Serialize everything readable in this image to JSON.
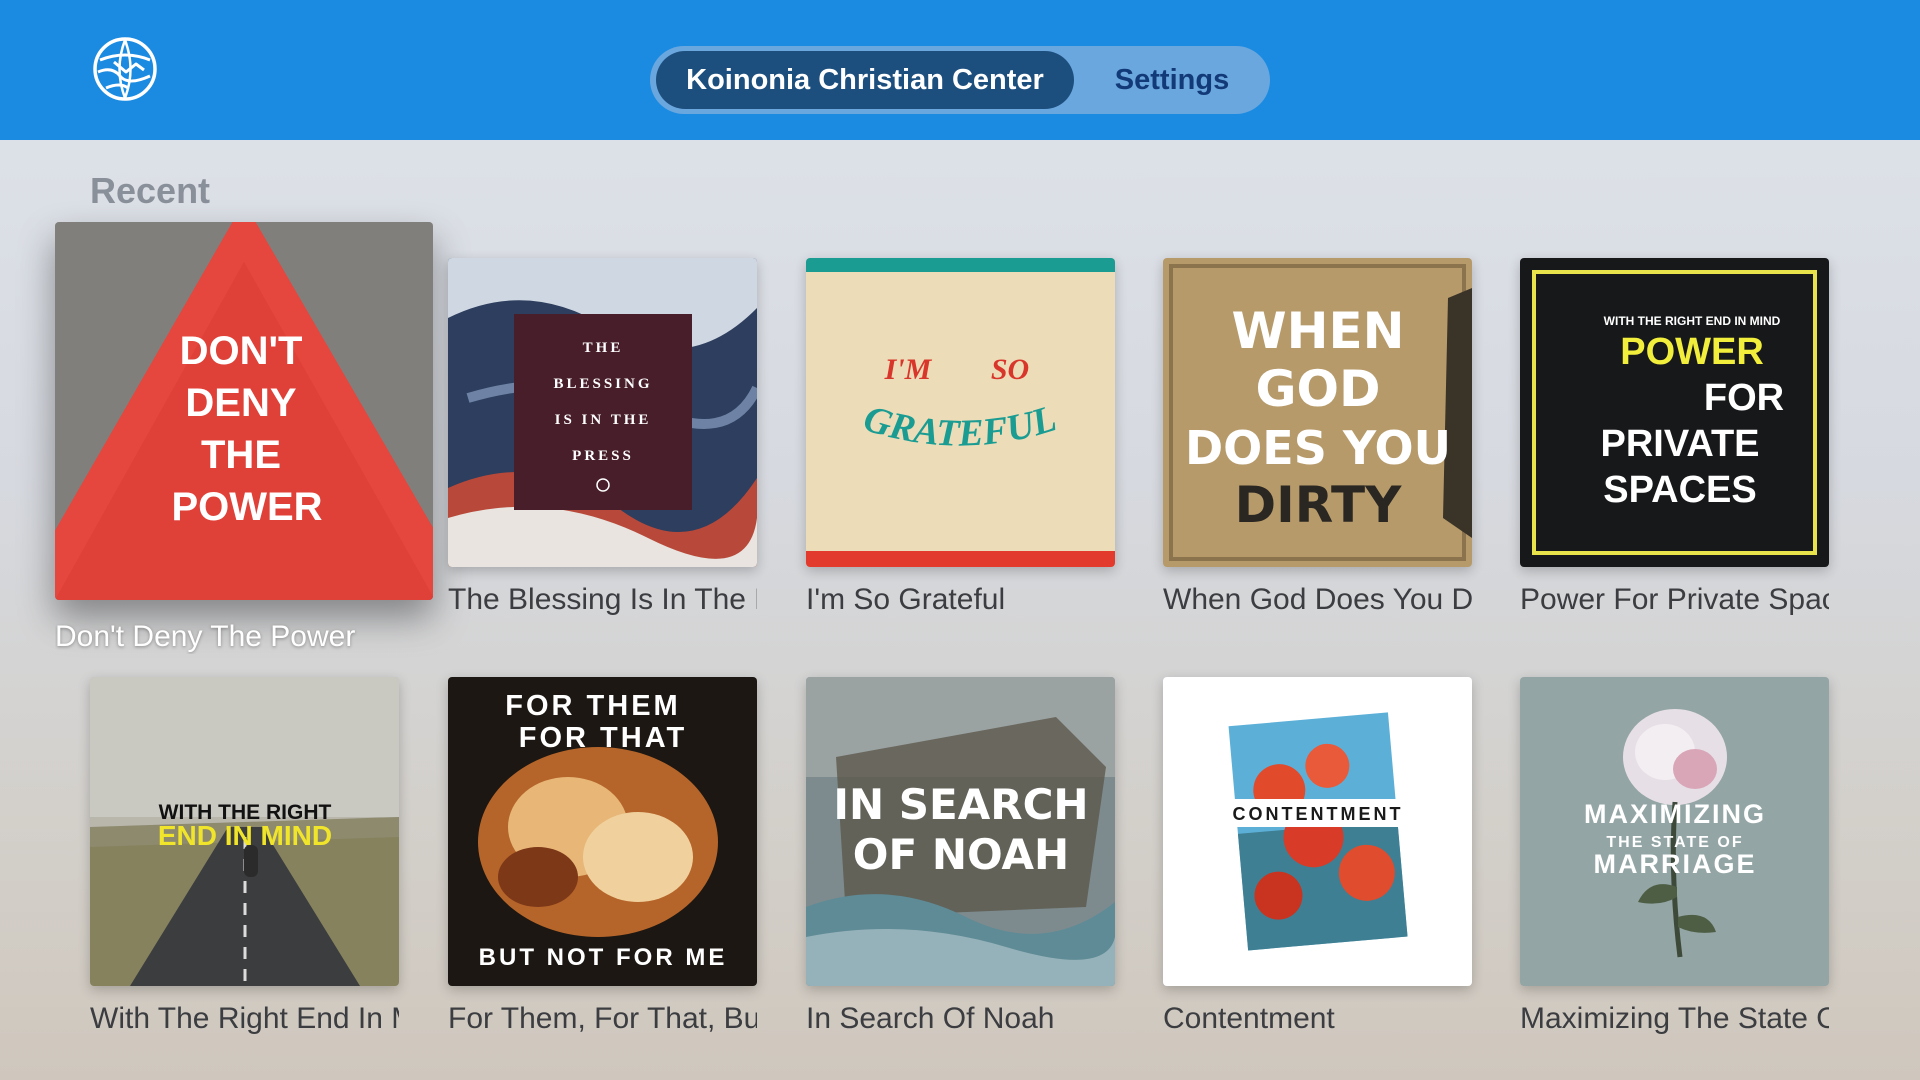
{
  "header": {
    "logo_icon": "globe-handshake-icon",
    "tabs": [
      {
        "label": "Koinonia Christian Center",
        "selected": true
      },
      {
        "label": "Settings",
        "selected": false
      }
    ]
  },
  "section": {
    "title": "Recent"
  },
  "colors": {
    "header_bg": "#1a8be0",
    "tab_selected_bg": "#1d4f7e",
    "tab_inactive_text": "#123a78"
  },
  "cards": [
    {
      "title": "Don't Deny The Power",
      "art": [
        "DON'T",
        "DENY",
        "THE",
        "POWER"
      ],
      "focused": true
    },
    {
      "title": "The Blessing Is In The Press",
      "art": [
        "THE",
        "BLESSING",
        "IS IN THE",
        "PRESS"
      ]
    },
    {
      "title": "I'm So Grateful",
      "art": [
        "I'M",
        "SO",
        "GRATEFUL"
      ]
    },
    {
      "title": "When God Does You Dirty",
      "art": [
        "WHEN",
        "GOD",
        "DOES YOU",
        "DIRTY"
      ]
    },
    {
      "title": "Power For Private Spaces",
      "art": [
        "WITH THE RIGHT END IN MIND",
        "POWER",
        "FOR",
        "PRIVATE",
        "SPACES"
      ]
    },
    {
      "title": "With The Right End In Mind",
      "art": [
        "WITH THE RIGHT",
        "END IN MIND"
      ]
    },
    {
      "title": "For Them, For That, But Not For Me",
      "art": [
        "FOR THEM",
        "FOR THAT",
        "BUT NOT FOR ME"
      ]
    },
    {
      "title": "In Search Of Noah",
      "art": [
        "IN SEARCH",
        "OF NOAH"
      ]
    },
    {
      "title": "Contentment",
      "art": [
        "CONTENTMENT"
      ]
    },
    {
      "title": "Maximizing The State Of Marriage",
      "art": [
        "MAXIMIZING",
        "THE STATE OF",
        "MARRIAGE"
      ]
    }
  ]
}
